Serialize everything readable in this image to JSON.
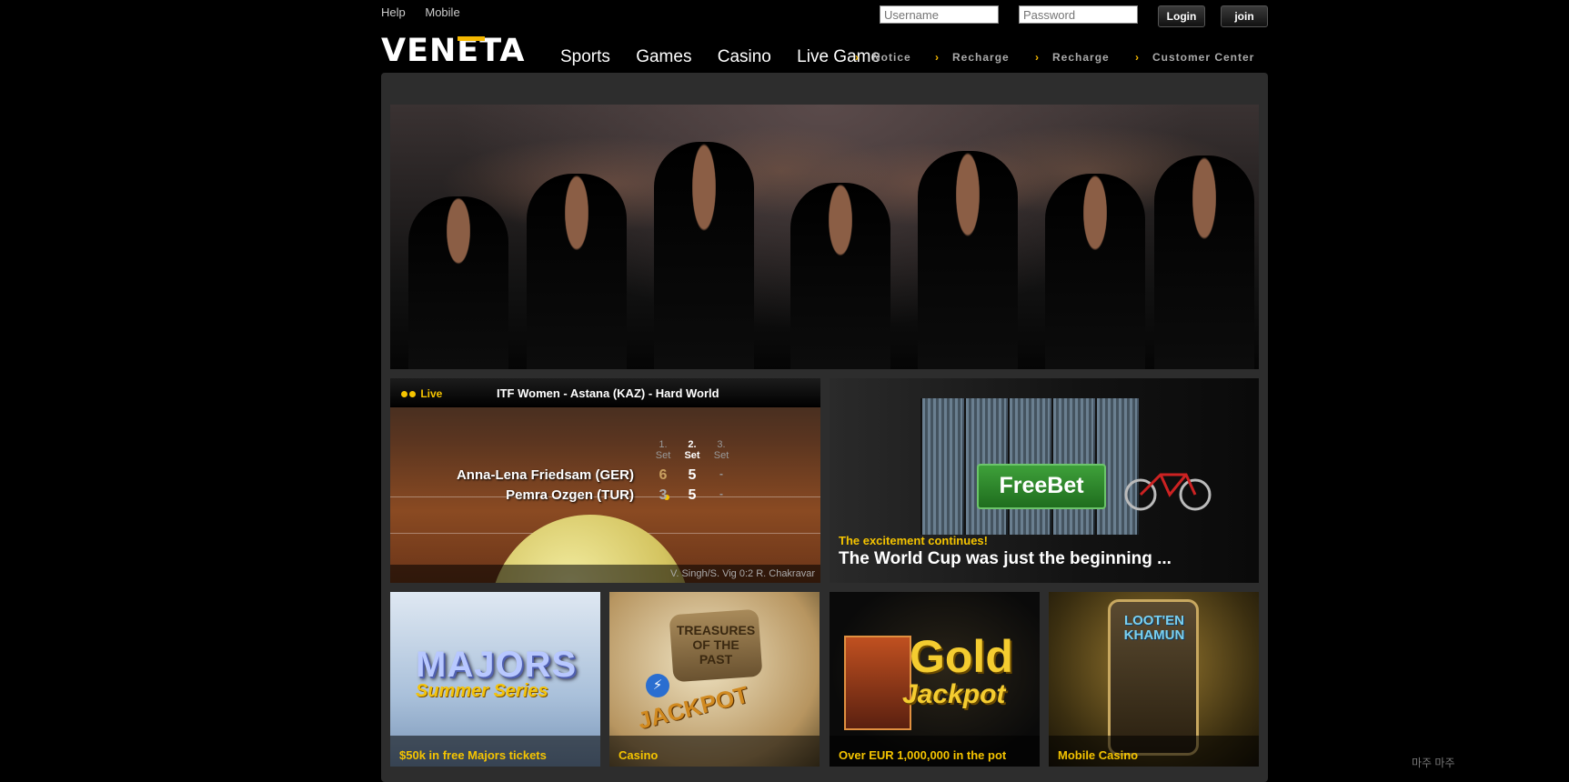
{
  "top_links": [
    "Help",
    "Mobile"
  ],
  "login": {
    "username_placeholder": "Username",
    "password_placeholder": "Password",
    "login_label": "Login",
    "join_label": "join"
  },
  "brand": {
    "logo_text": "VENETA",
    "accent_color": "#f5b800"
  },
  "main_nav": [
    "Sports",
    "Games",
    "Casino",
    "Live Game"
  ],
  "sub_nav": [
    "Notice",
    "Recharge",
    "Recharge",
    "Customer Center"
  ],
  "live_match": {
    "live_label": "Live",
    "title": "ITF Women - Astana (KAZ) - Hard World",
    "set_headers": [
      {
        "num": "1.",
        "label": "Set"
      },
      {
        "num": "2.",
        "label": "Set"
      },
      {
        "num": "3.",
        "label": "Set"
      }
    ],
    "players": [
      {
        "name": "Anna-Lena Friedsam (GER)",
        "set1": "6",
        "set2": "5",
        "set3": "-"
      },
      {
        "name": "Pemra Ozgen (TUR)",
        "set1": "3",
        "set2": "5",
        "set3": "-"
      }
    ],
    "footer": "V. Singh/S. Vig 0:2 R. Chakravar"
  },
  "freebet": {
    "button_label": "FreeBet",
    "subtitle": "The excitement continues!",
    "headline": "The World Cup was just the beginning ..."
  },
  "promos": [
    {
      "caption": "$50k in free Majors tickets",
      "art_title": "MAJORS",
      "art_sub": "Summer Series"
    },
    {
      "caption": "Casino",
      "art_title": "TREASURES OF THE PAST",
      "art_sub": "JACKPOT"
    },
    {
      "caption": "Over EUR 1,000,000 in the pot",
      "art_title": "Gold",
      "art_sub": "Jackpot"
    },
    {
      "caption": "Mobile Casino",
      "art_title": "LOOT'EN KHAMUN"
    }
  ],
  "corner_text": "마주 마주"
}
